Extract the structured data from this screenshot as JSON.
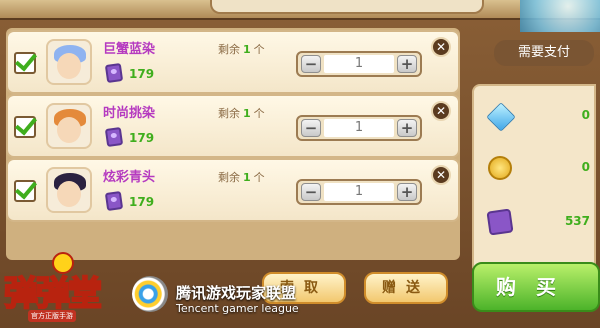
{
  "cart": {
    "items": [
      {
        "name": "巨蟹蓝染",
        "remain_label": "剩余",
        "remain_count": "1",
        "remain_unit": "个",
        "price": "179",
        "qty": "1",
        "hair_color": "#8fb3f0",
        "checked": true
      },
      {
        "name": "时尚挑染",
        "remain_label": "剩余",
        "remain_count": "1",
        "remain_unit": "个",
        "price": "179",
        "qty": "1",
        "hair_color": "#e48a3b",
        "checked": true
      },
      {
        "name": "炫彩青头",
        "remain_label": "剩余",
        "remain_count": "1",
        "remain_unit": "个",
        "price": "179",
        "qty": "1",
        "hair_color": "#2a2140",
        "checked": true
      }
    ],
    "minus_label": "−",
    "plus_label": "+",
    "remove_label": "✕"
  },
  "payment": {
    "title": "需要支付",
    "rows": [
      {
        "icon": "diamond-icon",
        "value": "0"
      },
      {
        "icon": "gold-coin-icon",
        "value": "0"
      },
      {
        "icon": "purple-gem-icon",
        "value": "537"
      }
    ]
  },
  "buttons": {
    "claim": "索取",
    "gift": "赠送",
    "buy": "购买"
  },
  "branding": {
    "game_logo": "弹弹堂",
    "game_logo_sub": "官方正版手游",
    "tencent_cn": "腾讯游戏玩家联盟",
    "tencent_en": "Tencent gamer league"
  },
  "colors": {
    "price_green": "#3fae1d",
    "name_purple": "#b53ac0",
    "buy_green": "#4cb32a"
  }
}
